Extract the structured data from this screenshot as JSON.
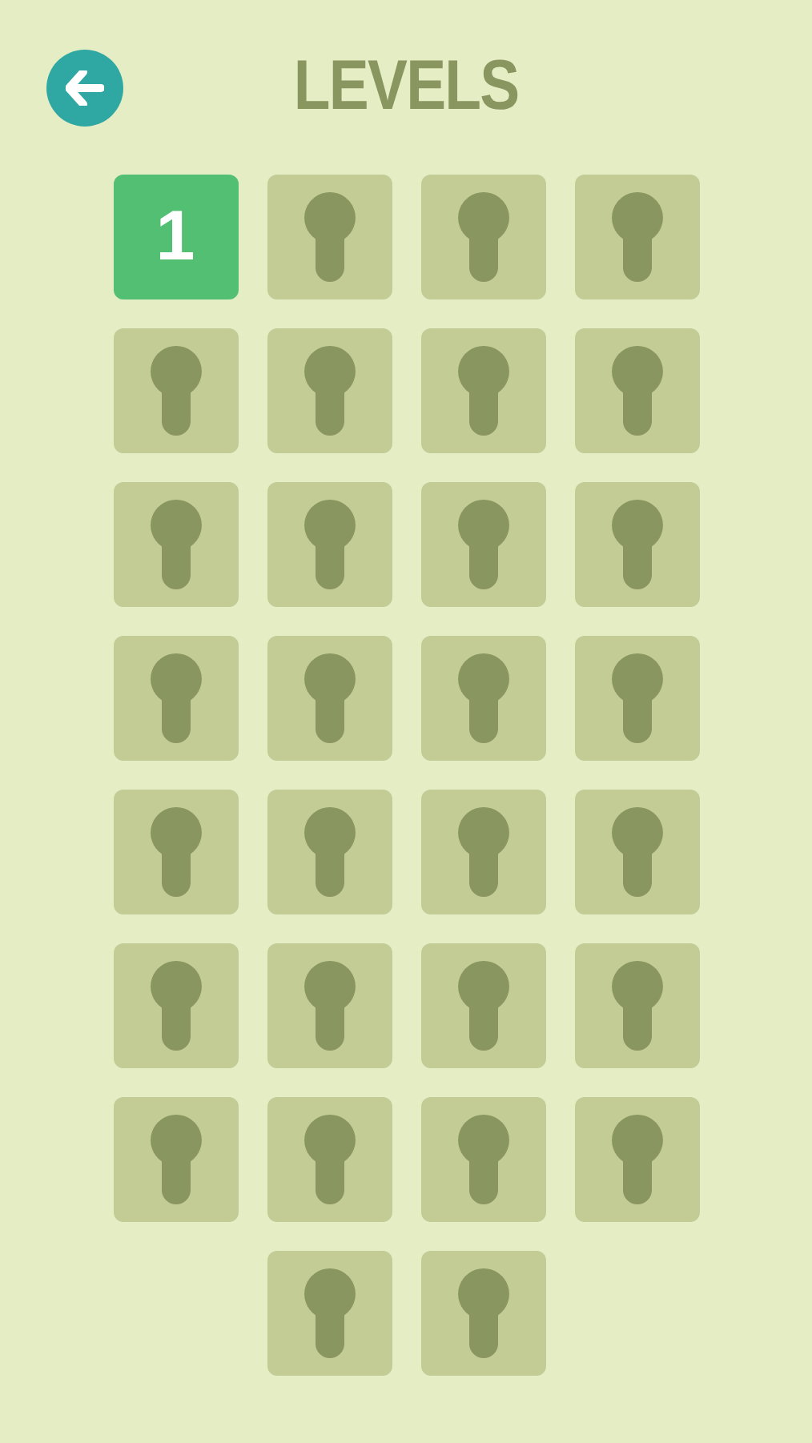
{
  "header": {
    "title": "LEVELS"
  },
  "levels": [
    {
      "locked": false,
      "label": "1"
    },
    {
      "locked": true
    },
    {
      "locked": true
    },
    {
      "locked": true
    },
    {
      "locked": true
    },
    {
      "locked": true
    },
    {
      "locked": true
    },
    {
      "locked": true
    },
    {
      "locked": true
    },
    {
      "locked": true
    },
    {
      "locked": true
    },
    {
      "locked": true
    },
    {
      "locked": true
    },
    {
      "locked": true
    },
    {
      "locked": true
    },
    {
      "locked": true
    },
    {
      "locked": true
    },
    {
      "locked": true
    },
    {
      "locked": true
    },
    {
      "locked": true
    },
    {
      "locked": true
    },
    {
      "locked": true
    },
    {
      "locked": true
    },
    {
      "locked": true
    },
    {
      "locked": true
    },
    {
      "locked": true
    },
    {
      "locked": true
    },
    {
      "locked": true
    },
    {
      "locked": true
    },
    {
      "locked": true
    }
  ]
}
